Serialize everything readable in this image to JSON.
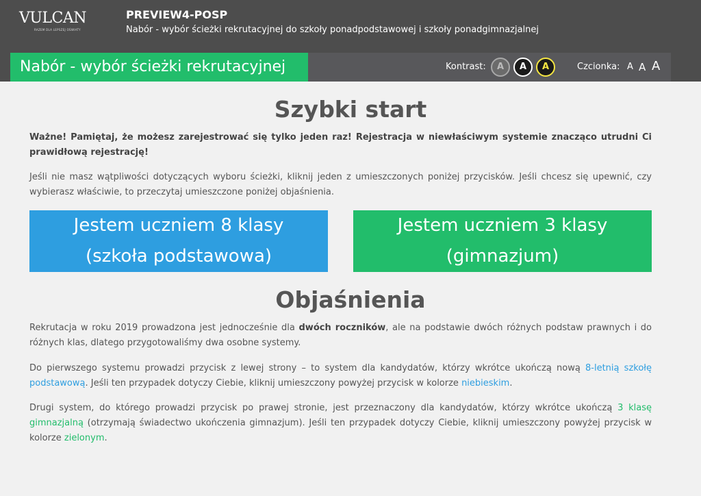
{
  "header": {
    "logo_text": "VULCAN",
    "logo_tagline": "RAZEM DLA LEPSZEJ OŚWIATY",
    "app_title": "PREVIEW4-POSP",
    "app_subtitle": "Nabór - wybór ścieżki rekrutacyjnej do szkoły ponadpodstawowej i szkoły ponadgimnazjalnej"
  },
  "subbar": {
    "section_title": "Nabór - wybór ścieżki rekrutacyjnej",
    "contrast_label": "Kontrast:",
    "contrast_options": [
      "A",
      "A",
      "A"
    ],
    "font_label": "Czcionka:",
    "font_options": [
      "A",
      "A",
      "A"
    ]
  },
  "quick_start": {
    "title": "Szybki start",
    "important": "Ważne! Pamiętaj, że możesz zarejestrować się tylko jeden raz! Rejestracja w niewłaściwym systemie znacząco utrudni Ci prawidłową rejestrację!",
    "intro": "Jeśli nie masz wątpliwości dotyczących wyboru ścieżki, kliknij jeden z umieszczonych poniżej przycisków. Jeśli chcesz się upewnić, czy wybierasz właściwie, to przeczytaj umieszczone poniżej objaśnienia.",
    "btn_primary_line1": "Jestem uczniem 8 klasy",
    "btn_primary_line2": "(szkoła podstawowa)",
    "btn_secondary_line1": "Jestem uczniem 3 klasy",
    "btn_secondary_line2": "(gimnazjum)"
  },
  "explanations": {
    "title": "Objaśnienia",
    "p1_a": "Rekrutacja w roku 2019 prowadzona jest jednocześnie dla ",
    "p1_strong": "dwóch roczników",
    "p1_b": ", ale na podstawie dwóch różnych podstaw prawnych i do różnych klas, dlatego przygotowaliśmy dwa osobne systemy.",
    "p2_a": "Do pierwszego systemu prowadzi przycisk z lewej strony – to system dla kandydatów, którzy wkrótce ukończą nową ",
    "p2_link": "8-letnią szkołę podstawową",
    "p2_b": ". Jeśli ten przypadek dotyczy Ciebie, kliknij umieszczony powyżej przycisk w kolorze ",
    "p2_color": "niebieskim",
    "p2_c": ".",
    "p3_a": "Drugi system, do którego prowadzi przycisk po prawej stronie, jest przeznaczony dla kandydatów, którzy wkrótce ukończą ",
    "p3_link": "3 klasę gimnazjalną",
    "p3_b": " (otrzymają świadectwo ukończenia gimnazjum). Jeśli ten przypadek dotyczy Ciebie, kliknij umieszczony powyżej przycisk w kolorze ",
    "p3_color": "zielonym",
    "p3_c": "."
  },
  "colors": {
    "header_bg": "#4d4d4d",
    "subbar_bg": "#58585b",
    "green": "#22bd6b",
    "blue": "#2e9ee0",
    "page_bg": "#f1f1f1"
  }
}
